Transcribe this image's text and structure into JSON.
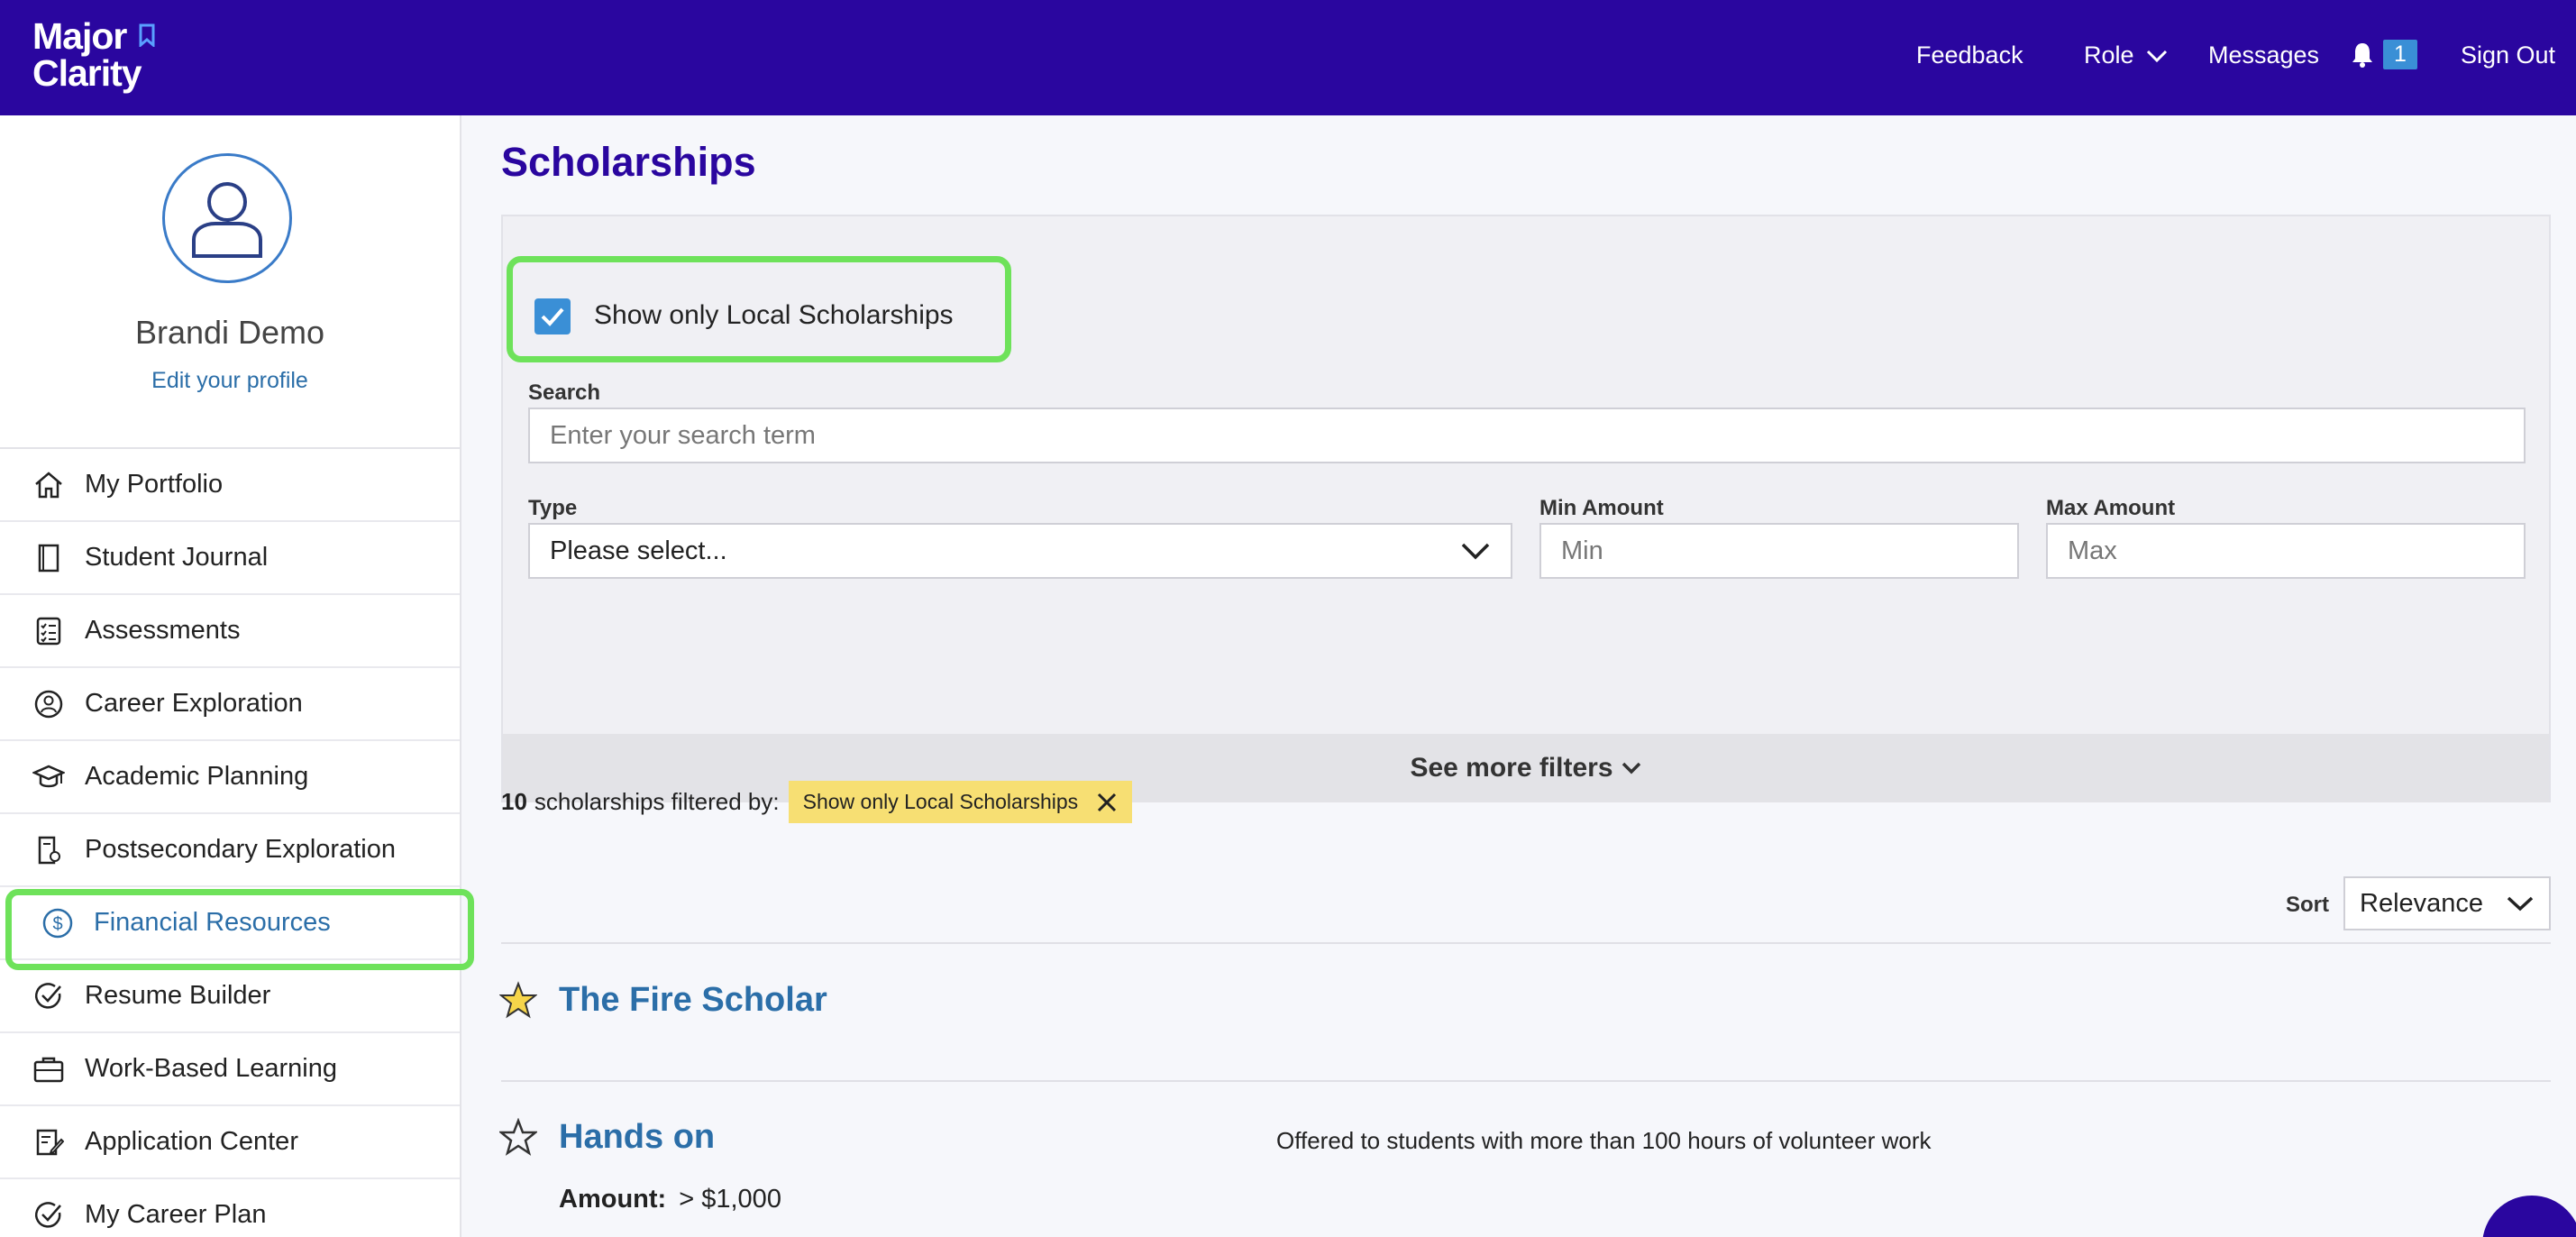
{
  "header": {
    "logo_line1": "Major",
    "logo_line2": "Clarity",
    "feedback": "Feedback",
    "role": "Role",
    "messages": "Messages",
    "notification_count": "1",
    "sign_out": "Sign Out"
  },
  "profile": {
    "name": "Brandi Demo",
    "edit_link": "Edit your profile"
  },
  "sidebar": {
    "items": [
      {
        "label": "My Portfolio",
        "icon": "home-icon"
      },
      {
        "label": "Student Journal",
        "icon": "journal-icon"
      },
      {
        "label": "Assessments",
        "icon": "checklist-icon"
      },
      {
        "label": "Career Exploration",
        "icon": "person-circle-icon"
      },
      {
        "label": "Academic Planning",
        "icon": "graduation-cap-icon"
      },
      {
        "label": "Postsecondary Exploration",
        "icon": "document-badge-icon"
      },
      {
        "label": "Financial Resources",
        "icon": "dollar-circle-icon",
        "active": true
      },
      {
        "label": "Resume Builder",
        "icon": "check-circle-icon"
      },
      {
        "label": "Work-Based Learning",
        "icon": "briefcase-icon"
      },
      {
        "label": "Application Center",
        "icon": "edit-document-icon"
      },
      {
        "label": "My Career Plan",
        "icon": "check-circle-icon"
      }
    ]
  },
  "main": {
    "title": "Scholarships",
    "filters": {
      "local_only_label": "Show only Local Scholarships",
      "local_only_checked": true,
      "search_label": "Search",
      "search_placeholder": "Enter your search term",
      "type_label": "Type",
      "type_value": "Please select...",
      "min_label": "Min Amount",
      "min_placeholder": "Min",
      "max_label": "Max Amount",
      "max_placeholder": "Max",
      "more_filters": "See more filters"
    },
    "results": {
      "count": "10",
      "filtered_by_text": "scholarships filtered by:",
      "chip_label": "Show only Local Scholarships"
    },
    "sort": {
      "label": "Sort",
      "value": "Relevance"
    },
    "scholarships": [
      {
        "title": "The Fire Scholar",
        "starred": true
      },
      {
        "title": "Hands on",
        "starred": false,
        "description": "Offered to students with more than 100 hours of volunteer work",
        "amount_label": "Amount:",
        "amount_value": "> $1,000"
      }
    ]
  },
  "colors": {
    "brand": "#2a069f",
    "link": "#2b6ea8",
    "highlight": "#6ee25a",
    "chip": "#f7df73",
    "checkbox": "#3a8fd6"
  }
}
